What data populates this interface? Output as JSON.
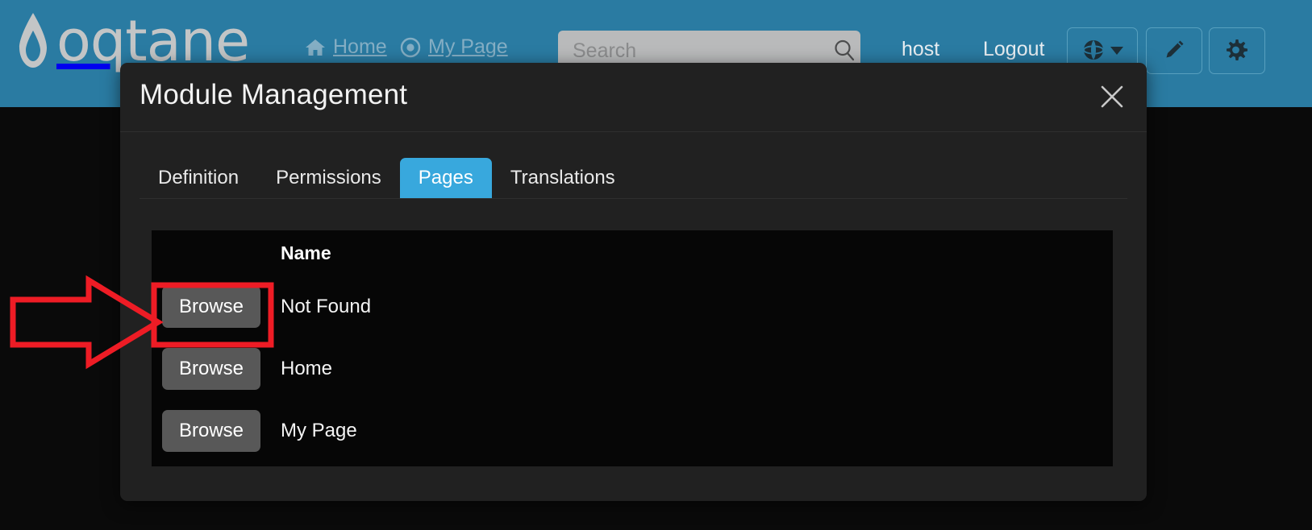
{
  "brand": {
    "name": "oqtane",
    "logo_icon": "water-drop-icon"
  },
  "colors": {
    "header_blue": "#2a7ba2",
    "accent_blue": "#38a8dd",
    "modal_bg": "#212121",
    "page_bg": "#0a0a0a",
    "table_bg": "#060606",
    "button_gray": "#585858",
    "annotation_red": "#ee1c25"
  },
  "header": {
    "nav": [
      {
        "label": "Home",
        "icon": "home-icon"
      },
      {
        "label": "My Page",
        "icon": "target-circle-icon"
      }
    ],
    "search": {
      "placeholder": "Search",
      "value": "",
      "icon": "search-icon"
    },
    "user": "host",
    "logout": "Logout",
    "buttons": [
      {
        "name": "language-selector",
        "icon": "globe-icon"
      },
      {
        "name": "edit-mode",
        "icon": "pencil-icon"
      },
      {
        "name": "site-settings",
        "icon": "gear-icon"
      }
    ]
  },
  "modal": {
    "title": "Module Management",
    "close_icon": "close-x-icon",
    "tabs": [
      {
        "label": "Definition",
        "active": false
      },
      {
        "label": "Permissions",
        "active": false
      },
      {
        "label": "Pages",
        "active": true
      },
      {
        "label": "Translations",
        "active": false
      }
    ],
    "table": {
      "columns": [
        "",
        "Name"
      ],
      "rows": [
        {
          "action": "Browse",
          "name": "Not Found"
        },
        {
          "action": "Browse",
          "name": "Home"
        },
        {
          "action": "Browse",
          "name": "My Page"
        }
      ]
    }
  },
  "annotations": {
    "arrow": "red-arrow-pointing-right",
    "highlight_box": "red-rectangle-around-first-browse-button"
  }
}
